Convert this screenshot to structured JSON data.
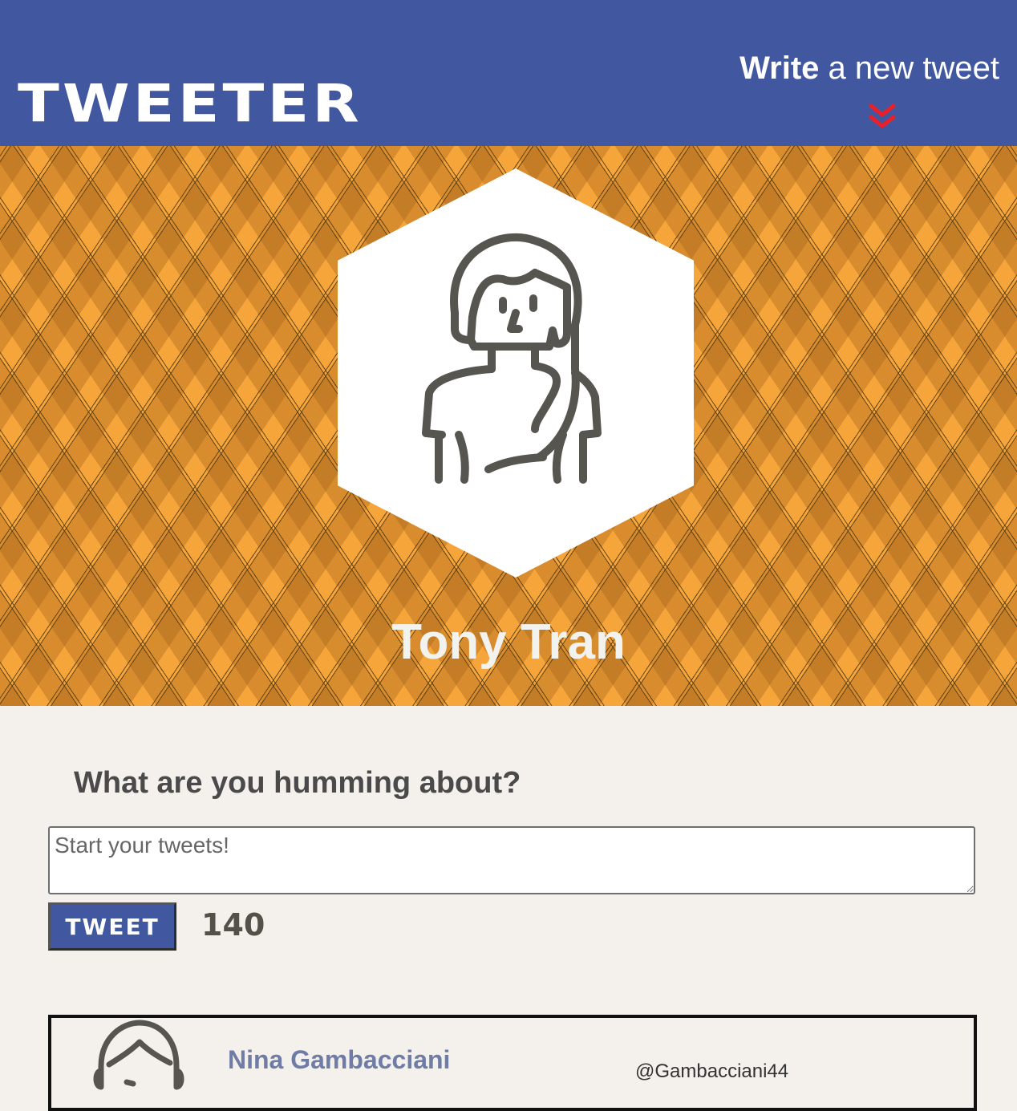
{
  "nav": {
    "logo": "TWEETER",
    "compose_bold": "Write",
    "compose_rest": " a new tweet",
    "toggle_icon": "double-chevron-down-icon",
    "toggle_color": "#e8202a"
  },
  "profile": {
    "name": "Tony Tran",
    "avatar_icon": "user-avatar-girl-icon"
  },
  "new_tweet": {
    "prompt": "What are you humming about?",
    "placeholder": "Start your tweets!",
    "button_label": "TWEET",
    "counter": "140"
  },
  "tweets": [
    {
      "name": "Nina Gambacciani",
      "handle": "@Gambacciani44",
      "avatar_icon": "user-avatar-icon"
    }
  ],
  "colors": {
    "nav_bg": "#41579f",
    "hero_bg": "#f6a53a",
    "page_bg": "#f4f1ec",
    "avatar_stroke": "#575550"
  }
}
